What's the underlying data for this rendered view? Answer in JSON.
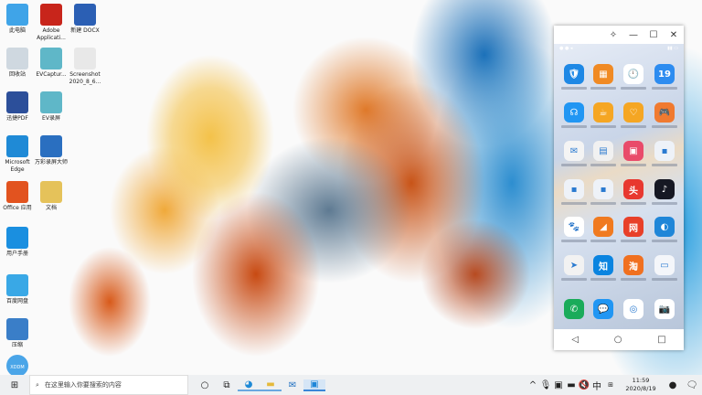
{
  "desktop_icons": [
    {
      "label": "此电脑",
      "color": "#3fa4e8"
    },
    {
      "label": "Adobe Applicati...",
      "color": "#c8251b"
    },
    {
      "label": "新建 DOCX",
      "color": "#2b5fb4"
    },
    {
      "label": "回收站",
      "color": "#cfd8e0"
    },
    {
      "label": "EVCaptur...",
      "color": "#5fb7c8"
    },
    {
      "label": "Screenshot 2020_8_6...",
      "color": "#e8e8e8"
    },
    {
      "label": "迅捷PDF",
      "color": "#2c4f9a"
    },
    {
      "label": "EV录屏",
      "color": "#5fb7c8"
    },
    {
      "label": "Microsoft Edge",
      "color": "#1f8ad6"
    },
    {
      "label": "万彩录屏大师",
      "color": "#2a6fc0"
    },
    {
      "label": "Office 应用",
      "color": "#e2531f"
    },
    {
      "label": "文档",
      "color": "#e5c25a"
    },
    {
      "label": "用户手册",
      "color": "#1a8fe0"
    },
    {
      "label": "百度网盘",
      "color": "#39a8e6"
    },
    {
      "label": "压缩",
      "color": "#3a7ec8"
    },
    {
      "label": "XDDM",
      "color": "#4aa5e8"
    }
  ],
  "phone": {
    "title_buttons": [
      "pin",
      "minimize",
      "maximize",
      "close"
    ],
    "calendar_day": "19",
    "apps": [
      {
        "icon": "shield",
        "color": "#1e88e5",
        "glyph": "🛡"
      },
      {
        "icon": "files",
        "color": "#f08a24",
        "glyph": "▦"
      },
      {
        "icon": "clock",
        "color": "#ffffff",
        "glyph": "🕛"
      },
      {
        "icon": "calendar",
        "color": "#2d8cf0",
        "glyph": "19"
      },
      {
        "icon": "support",
        "color": "#2196f3",
        "glyph": "☊"
      },
      {
        "icon": "cup",
        "color": "#f5a623",
        "glyph": "☕"
      },
      {
        "icon": "heart",
        "color": "#f5a623",
        "glyph": "♡"
      },
      {
        "icon": "game",
        "color": "#f07a30",
        "glyph": "🎮"
      },
      {
        "icon": "mail",
        "color": "#f4f4f4",
        "glyph": "✉"
      },
      {
        "icon": "notes",
        "color": "#f1f1f1",
        "glyph": "▤"
      },
      {
        "icon": "shop",
        "color": "#e94b6a",
        "glyph": "▣"
      },
      {
        "icon": "folder",
        "color": "#eef2f8",
        "glyph": "▪"
      },
      {
        "icon": "folder",
        "color": "#eef2f8",
        "glyph": "▪"
      },
      {
        "icon": "folder",
        "color": "#eef2f8",
        "glyph": "▪"
      },
      {
        "icon": "toutiao",
        "color": "#e8382f",
        "glyph": "头"
      },
      {
        "icon": "tiktok",
        "color": "#161823",
        "glyph": "♪"
      },
      {
        "icon": "baidu",
        "color": "#ffffff",
        "glyph": "🐾"
      },
      {
        "icon": "news",
        "color": "#f07a20",
        "glyph": "◢"
      },
      {
        "icon": "netease",
        "color": "#e8402a",
        "glyph": "网"
      },
      {
        "icon": "dolphin",
        "color": "#1f86d8",
        "glyph": "◐"
      },
      {
        "icon": "maps",
        "color": "#f2f2f2",
        "glyph": "➤"
      },
      {
        "icon": "zhihu",
        "color": "#0a84e0",
        "glyph": "知"
      },
      {
        "icon": "taobao",
        "color": "#f07020",
        "glyph": "淘"
      },
      {
        "icon": "scanner",
        "color": "#f4f6fa",
        "glyph": "▭"
      }
    ],
    "dock": [
      {
        "icon": "phone",
        "color": "#1aab5a",
        "glyph": "✆"
      },
      {
        "icon": "messages",
        "color": "#2196f3",
        "glyph": "💬"
      },
      {
        "icon": "browser",
        "color": "#ffffff",
        "glyph": "◎"
      },
      {
        "icon": "camera",
        "color": "#ffffff",
        "glyph": "📷"
      }
    ]
  },
  "taskbar": {
    "search_placeholder": "在这里输入你要搜索的内容",
    "ime": "中",
    "time": "11:59",
    "date": "2020/8/19"
  }
}
